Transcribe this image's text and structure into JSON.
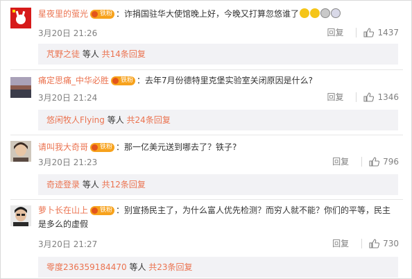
{
  "comments": [
    {
      "username": "星夜里的萤光",
      "badge": "铁粉",
      "separator": "：",
      "text": "诈捐国驻华大使馆晚上好，今晚又打算忽悠谁了",
      "emojis": [
        "smirk-emoji",
        "grin-emoji",
        "crying-emoji",
        "face-emoji"
      ],
      "time": "3月20日 21:26",
      "reply_label": "回复",
      "likes": "1437",
      "sub_user": "芃野之徒",
      "sub_mid": " 等人 ",
      "sub_count": "共14条回复"
    },
    {
      "username": "痛定思痛_中华必胜",
      "badge": "铁粉",
      "separator": "：",
      "text": "去年7月份德特里克堡实验室关闭原因是什么?",
      "time": "3月20日 21:24",
      "reply_label": "回复",
      "likes": "1346",
      "sub_user": "悠闲牧人Flying",
      "sub_mid": " 等人 ",
      "sub_count": "共24条回复"
    },
    {
      "username": "请叫我大奇哥",
      "badge": "铁粉",
      "separator": "：",
      "text": "那一亿美元送到哪去了？铁子?",
      "time": "3月20日 21:23",
      "reply_label": "回复",
      "likes": "796",
      "sub_user": "奇迹登录",
      "sub_mid": " 等人 ",
      "sub_count": "共12条回复"
    },
    {
      "username": "萝卜长在山上",
      "badge": "铁粉",
      "separator": "：",
      "text": "别宣扬民主了，为什么富人优先检测？而穷人就不能？你们的平等，民主是多么的虚假",
      "time": "3月20日 21:27",
      "reply_label": "回复",
      "likes": "730",
      "sub_user": "零度236359184470",
      "sub_mid": " 等人 ",
      "sub_count": "共23条回复"
    }
  ]
}
